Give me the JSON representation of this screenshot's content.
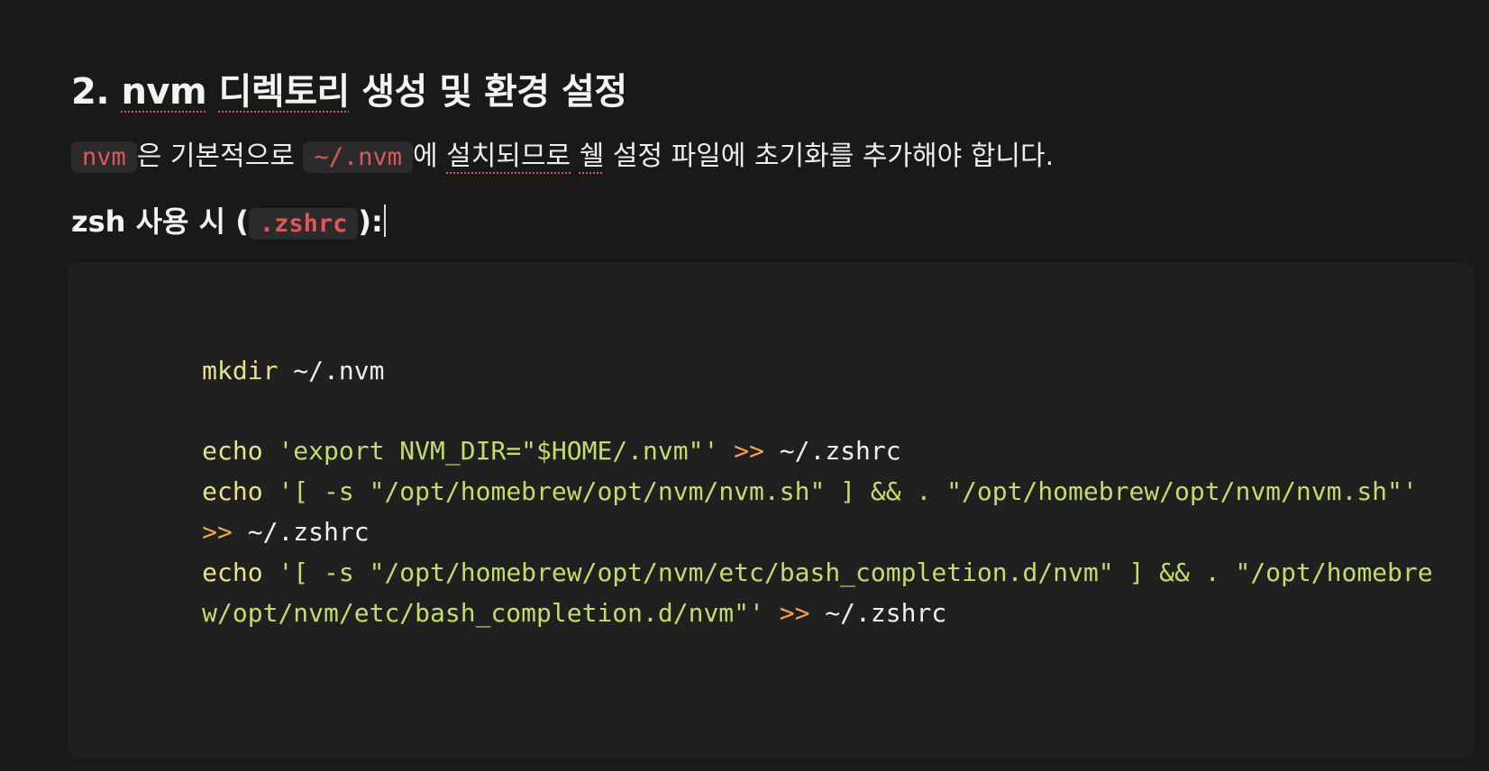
{
  "heading": {
    "prefix": "2. ",
    "word_nvm": "nvm",
    "space1": " ",
    "word_dir": "디렉토리",
    "rest": " 생성 및 환경 설정"
  },
  "paragraph": {
    "code1": "nvm",
    "text1": "은 기본적으로 ",
    "code2": "~/.nvm",
    "text2": "에 ",
    "word_install": "설치되므로",
    "space": " ",
    "word_shell": "쉘",
    "text3": " 설정 파일에 초기화를 추가해야 합니다."
  },
  "zsh_label": {
    "prefix": "zsh 사용 시 (",
    "code": ".zshrc",
    "suffix": "):"
  },
  "code": {
    "l1_cmd": "mkdir",
    "l1_arg": " ~/.nvm",
    "l2_cmd": "echo",
    "l2_str": " 'export NVM_DIR=\"$HOME/.nvm\"'",
    "l2_op": " >>",
    "l2_arg": " ~/.zshrc",
    "l3_cmd": "echo",
    "l3_str": " '[ -s \"/opt/homebrew/opt/nvm/nvm.sh\" ] && . \"/opt/homebrew/opt/nvm/nvm.sh\"'",
    "l4_op": ">>",
    "l4_arg": " ~/.zshrc",
    "l5_cmd": "echo",
    "l5_str": " '[ -s \"/opt/homebrew/opt/nvm/etc/bash_completion.d/nvm\" ] && . \"/opt/homebre",
    "l6_str": "w/opt/nvm/etc/bash_completion.d/nvm\"'",
    "l6_op": " >>",
    "l6_arg": " ~/.zshrc"
  }
}
